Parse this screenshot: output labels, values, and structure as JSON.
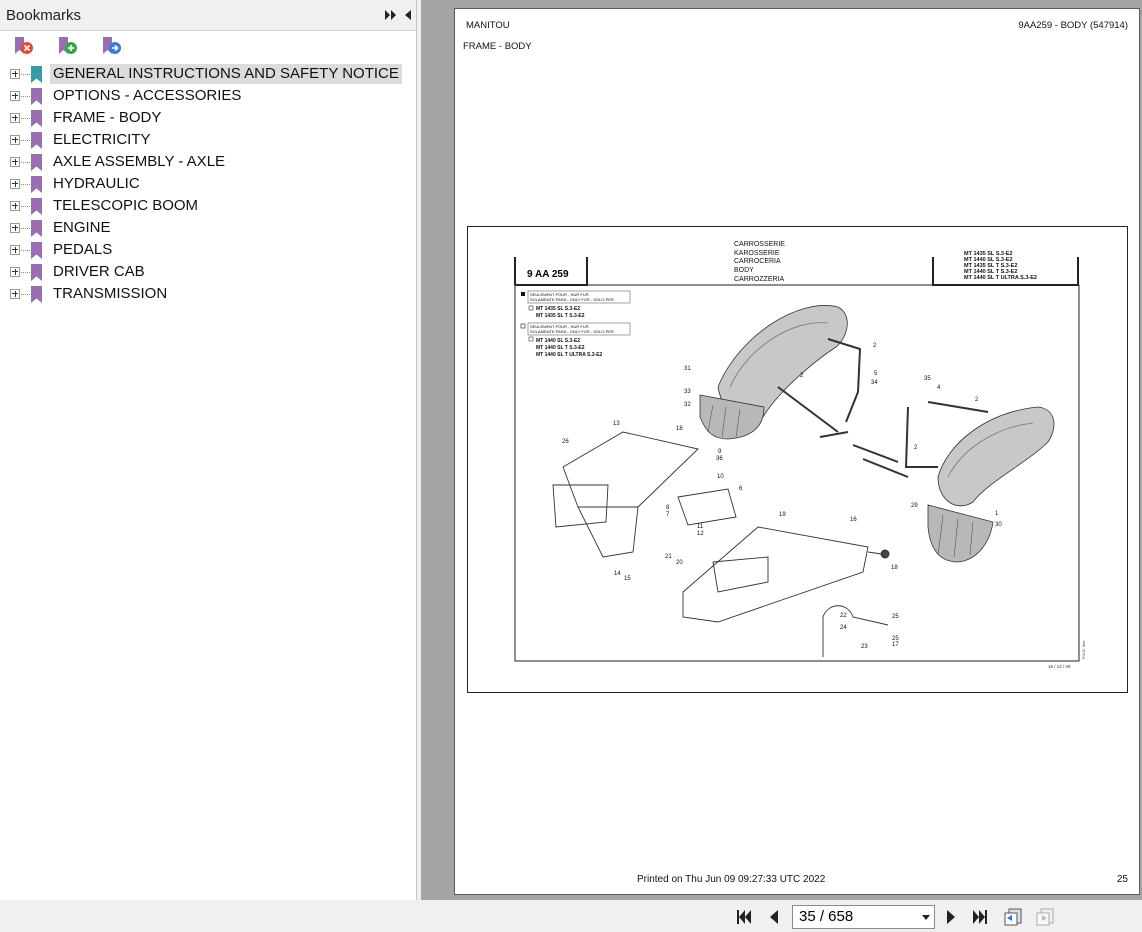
{
  "sidebar": {
    "title": "Bookmarks",
    "items": [
      {
        "label": "GENERAL INSTRUCTIONS AND SAFETY NOTICE",
        "selected": true
      },
      {
        "label": "OPTIONS - ACCESSORIES"
      },
      {
        "label": "FRAME - BODY"
      },
      {
        "label": "ELECTRICITY"
      },
      {
        "label": "AXLE ASSEMBLY - AXLE"
      },
      {
        "label": "HYDRAULIC"
      },
      {
        "label": "TELESCOPIC BOOM"
      },
      {
        "label": "ENGINE"
      },
      {
        "label": "PEDALS"
      },
      {
        "label": "DRIVER CAB"
      },
      {
        "label": "TRANSMISSION"
      }
    ],
    "icons": [
      "delete-bookmark-icon",
      "add-bookmark-icon",
      "goto-bookmark-icon"
    ]
  },
  "document": {
    "header_left": "MANITOU",
    "header_right": "9AA259 - BODY (547914)",
    "subtitle": "FRAME - BODY",
    "drawing": {
      "ref": "9 AA 259",
      "titles": [
        "CARROSSERIE",
        "KAROSSERIE",
        "CARROCERIA",
        "BODY",
        "CARROZZERIA"
      ],
      "models": [
        "MT 1435 SL S.3-E2",
        "MT 1440 SL S.3-E2",
        "MT 1435 SL T S.3-E2",
        "MT 1440 SL T S.3-E2",
        "MT 1440 SL T ULTRA S.3-E2"
      ],
      "note1_title": "SEULEMENT POUR - NUR FUR",
      "note1_sub": "SOLAMENTE PARA - ONLY FOR - SOLO PER",
      "note1_models": [
        "MT 1435 SL S.3-E2",
        "MT 1435 SL T S.3-E2"
      ],
      "note2_title": "SEULEMENT POUR - NUR FUR",
      "note2_sub": "SOLAMENTE PARA - ONLY FOR - SOLO PER",
      "note2_models": [
        "MT 1440 SL S.3-E2",
        "MT 1440 SL T S.3-E2",
        "MT 1440 SL T ULTRA S.3-E2"
      ],
      "date": "16 / 12 / 09",
      "side_note": "P.A.D. /lee",
      "callouts": [
        "31",
        "33",
        "32",
        "2",
        "2",
        "5",
        "34",
        "35",
        "4",
        "2",
        "2",
        "13",
        "18",
        "9",
        "36",
        "26",
        "10",
        "6",
        "8",
        "7",
        "11",
        "12",
        "19",
        "16",
        "18",
        "29",
        "1",
        "30",
        "21",
        "20",
        "14",
        "15",
        "22",
        "24",
        "25",
        "23",
        "25",
        "17"
      ]
    },
    "footer_printed": "Printed on  Thu Jun 09 09:27:33 UTC 2022",
    "page_number": "25"
  },
  "navigation": {
    "page_display": "35 / 658",
    "icons": [
      "first-page-icon",
      "previous-page-icon",
      "next-page-icon",
      "last-page-icon",
      "previous-view-icon",
      "next-view-icon"
    ]
  }
}
